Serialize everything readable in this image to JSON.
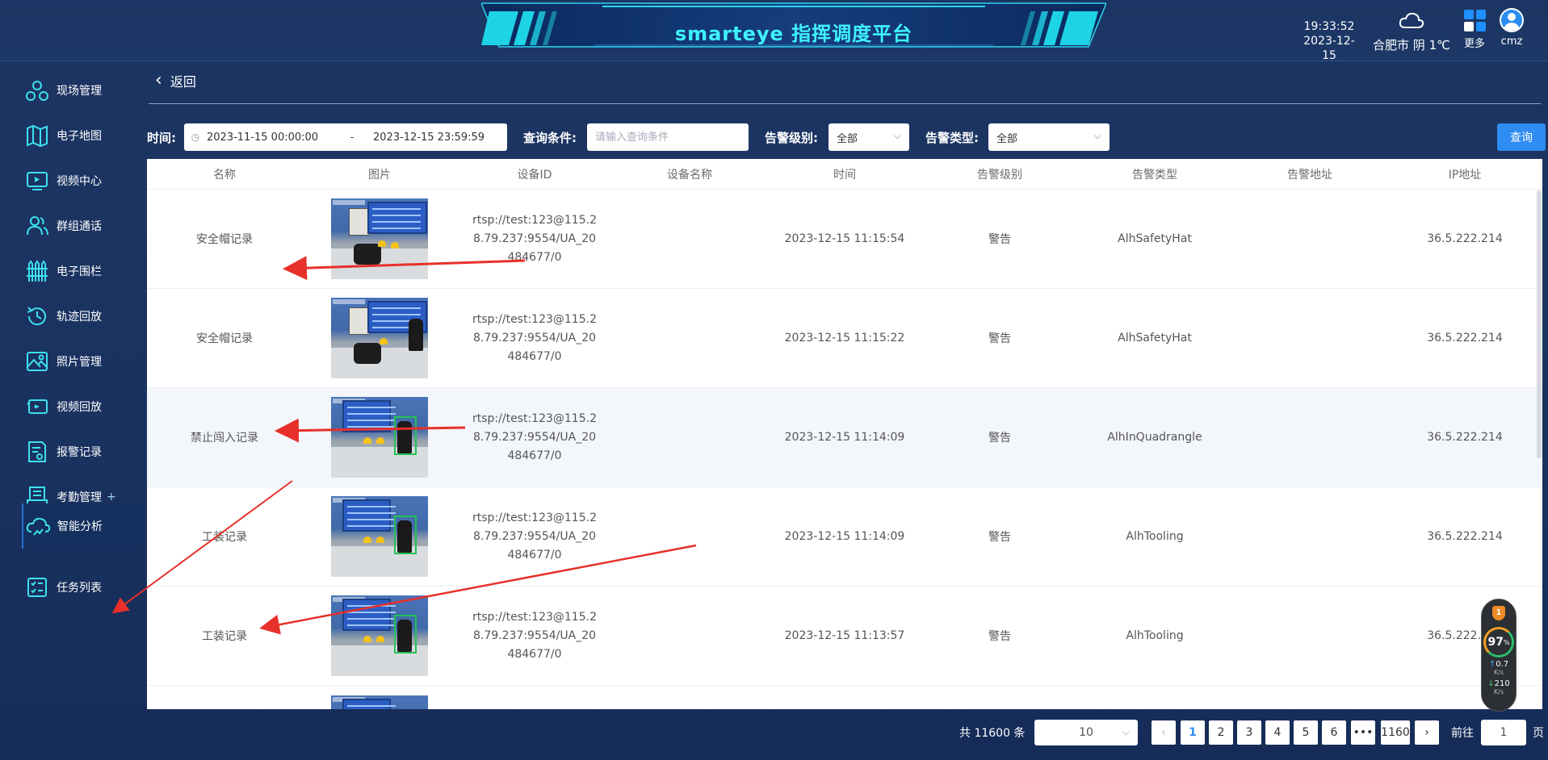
{
  "header": {
    "title": "smarteye 指挥调度平台",
    "time": "19:33:52",
    "date": "2023-12-15",
    "weather_icon": "cloud-icon",
    "weather": "合肥市 阴 1℃",
    "more_label": "更多",
    "user_name": "cmz"
  },
  "sidebar": {
    "items": [
      {
        "label": "现场管理",
        "icon": "scene-icon"
      },
      {
        "label": "电子地图",
        "icon": "map-icon"
      },
      {
        "label": "视频中心",
        "icon": "video-icon"
      },
      {
        "label": "群组通话",
        "icon": "group-icon"
      },
      {
        "label": "电子围栏",
        "icon": "fence-icon"
      },
      {
        "label": "轨迹回放",
        "icon": "history-icon"
      },
      {
        "label": "照片管理",
        "icon": "photo-icon"
      },
      {
        "label": "视频回放",
        "icon": "playback-icon"
      },
      {
        "label": "报警记录",
        "icon": "alarm-record-icon"
      },
      {
        "label": "考勤管理",
        "icon": "attendance-icon",
        "suffix": "+"
      },
      {
        "label": "智能分析",
        "icon": "ai-analysis-icon",
        "active": true
      },
      {
        "label": "任务列表",
        "icon": "task-list-icon"
      }
    ]
  },
  "back_label": "返回",
  "filters": {
    "time_label": "时间:",
    "start": "2023-11-15 00:00:00",
    "range_sep": "-",
    "end": "2023-12-15 23:59:59",
    "query_label": "查询条件:",
    "query_placeholder": "请输入查询条件",
    "level_label": "告警级别:",
    "level_value": "全部",
    "type_label": "告警类型:",
    "type_value": "全部",
    "search_button": "查询"
  },
  "table": {
    "columns": [
      "名称",
      "图片",
      "设备ID",
      "设备名称",
      "时间",
      "告警级别",
      "告警类型",
      "告警地址",
      "IP地址"
    ],
    "rows": [
      {
        "name": "安全帽记录",
        "device_id": "rtsp://test:123@115.28.79.237:9554/UA_20484677/0",
        "device_name": "",
        "time": "2023-12-15 11:15:54",
        "level": "警告",
        "type": "AlhSafetyHat",
        "address": "",
        "ip": "36.5.222.214"
      },
      {
        "name": "安全帽记录",
        "device_id": "rtsp://test:123@115.28.79.237:9554/UA_20484677/0",
        "device_name": "",
        "time": "2023-12-15 11:15:22",
        "level": "警告",
        "type": "AlhSafetyHat",
        "address": "",
        "ip": "36.5.222.214"
      },
      {
        "name": "禁止闯入记录",
        "device_id": "rtsp://test:123@115.28.79.237:9554/UA_20484677/0",
        "device_name": "",
        "time": "2023-12-15 11:14:09",
        "level": "警告",
        "type": "AlhInQuadrangle",
        "address": "",
        "ip": "36.5.222.214"
      },
      {
        "name": "工装记录",
        "device_id": "rtsp://test:123@115.28.79.237:9554/UA_20484677/0",
        "device_name": "",
        "time": "2023-12-15 11:14:09",
        "level": "警告",
        "type": "AlhTooling",
        "address": "",
        "ip": "36.5.222.214"
      },
      {
        "name": "工装记录",
        "device_id": "rtsp://test:123@115.28.79.237:9554/UA_20484677/0",
        "device_name": "",
        "time": "2023-12-15 11:13:57",
        "level": "警告",
        "type": "AlhTooling",
        "address": "",
        "ip": "36.5.222.214"
      }
    ]
  },
  "pagination": {
    "total": "共 11600 条",
    "page_size": "10",
    "prev": "‹",
    "pages": [
      "1",
      "2",
      "3",
      "4",
      "5",
      "6"
    ],
    "ellipsis": "•••",
    "last": "1160",
    "next": "›",
    "goto_label": "前往",
    "goto_value": "1",
    "page_unit": "页",
    "current_page": 1
  },
  "monitor": {
    "badge": "1",
    "percent": "97",
    "percent_unit": "%",
    "upload": "0.7",
    "download": "210",
    "speed_unit": "K/s"
  },
  "colors": {
    "accent": "#2f8cf2",
    "title": "#3ef3ff",
    "annotation_arrow": "#e8302a"
  }
}
